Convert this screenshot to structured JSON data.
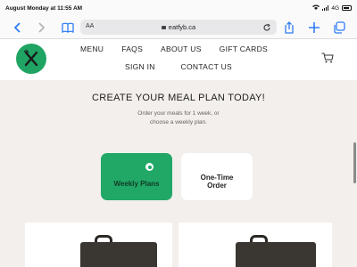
{
  "status_bar": {
    "time": "August Monday at 11:55 AM",
    "network": "4G"
  },
  "browser": {
    "text_size_label": "AA",
    "url": "eatfyb.ca",
    "icons": [
      "back-icon",
      "forward-icon",
      "bookmarks-icon",
      "lock-icon",
      "reload-icon",
      "share-icon",
      "new-tab-icon",
      "tabs-icon"
    ],
    "accent_color": "#2f7cf6"
  },
  "header": {
    "logo_color": "#1fa463",
    "nav_row1": [
      "MENU",
      "FAQS",
      "ABOUT US",
      "GIFT CARDS"
    ],
    "nav_row2": [
      "SIGN IN",
      "CONTACT US"
    ]
  },
  "main": {
    "heading": "CREATE YOUR MEAL PLAN TODAY!",
    "subtext_line1": "Order your meals for 1 week, or",
    "subtext_line2": "choose a weekly plan.",
    "options": [
      {
        "label": "Weekly Plans",
        "selected": true,
        "color": "#22a866"
      },
      {
        "label_line1": "One-Time",
        "label_line2": "Order",
        "selected": false
      }
    ]
  },
  "page_background": "#f2efec"
}
